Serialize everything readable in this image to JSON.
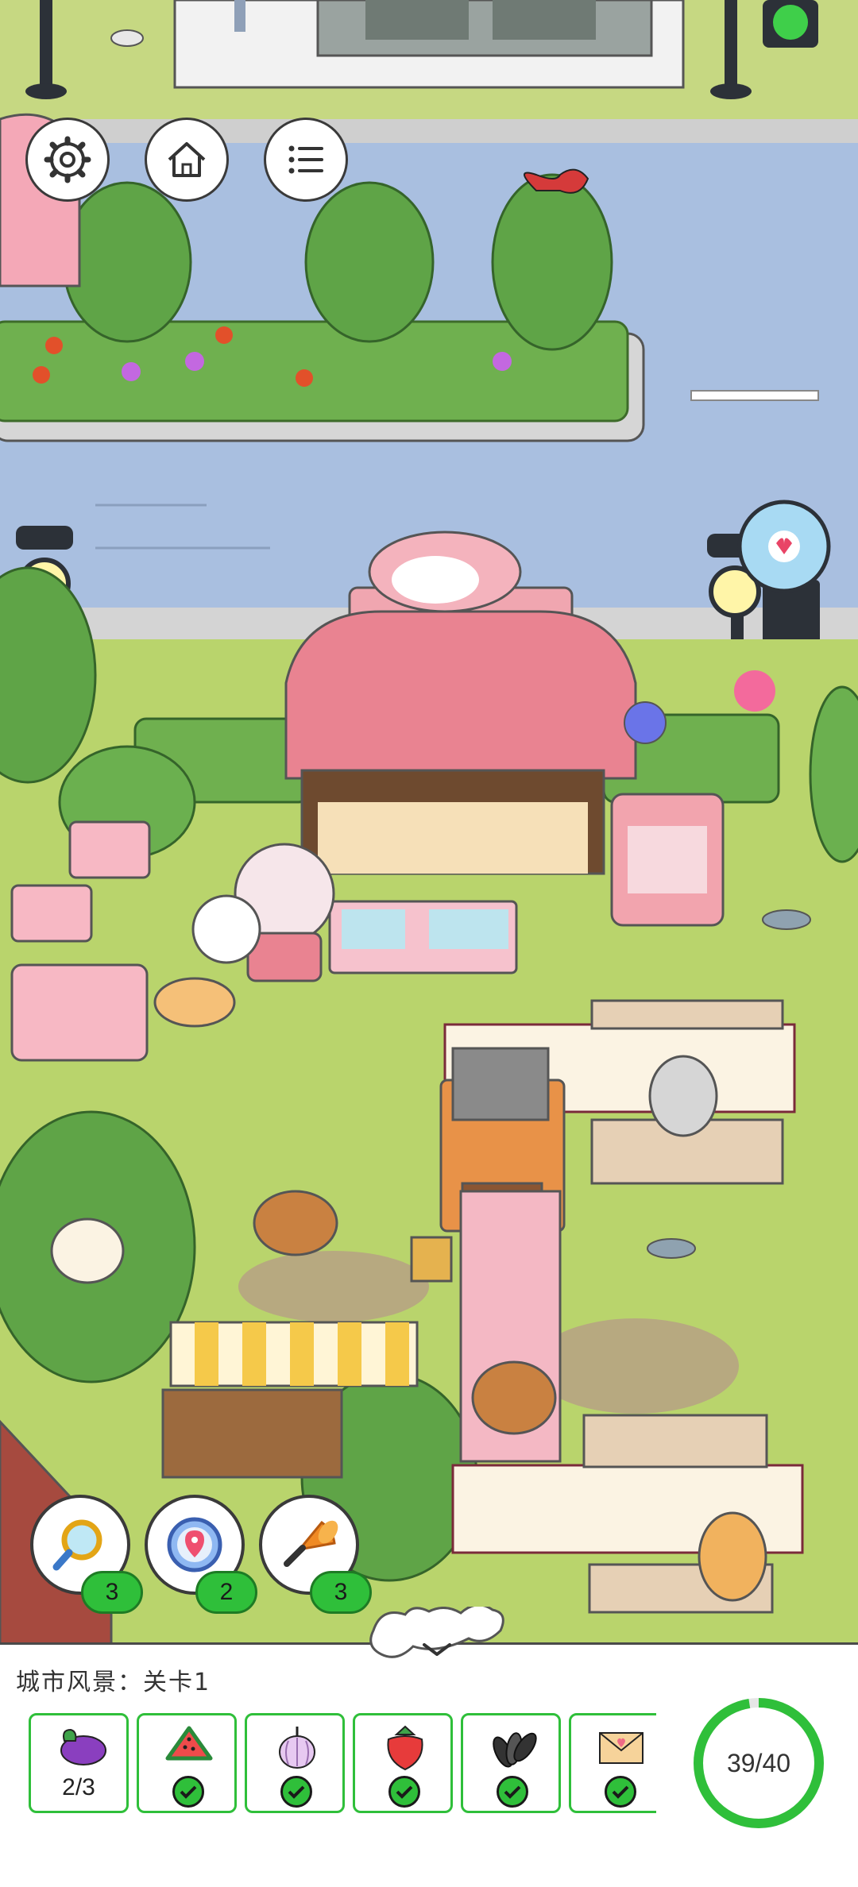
{
  "top_buttons": [
    {
      "icon": "gear-icon"
    },
    {
      "icon": "home-icon"
    },
    {
      "icon": "list-icon"
    }
  ],
  "tools": [
    {
      "icon": "magnifier-icon",
      "count": "3"
    },
    {
      "icon": "compass-icon",
      "count": "2"
    },
    {
      "icon": "horn-icon",
      "count": "3"
    }
  ],
  "panel": {
    "level_label": "城市风景：关卡1",
    "items": [
      {
        "icon": "eggplant-icon",
        "count": "2/3",
        "found": false
      },
      {
        "icon": "watermelon-icon",
        "found": true
      },
      {
        "icon": "garlic-icon",
        "found": true
      },
      {
        "icon": "strawberry-icon",
        "found": true
      },
      {
        "icon": "sunflower-seeds-icon",
        "found": true
      },
      {
        "icon": "envelope-icon",
        "found": true
      }
    ],
    "progress_text": "39/40",
    "progress_value": 0.975
  },
  "colors": {
    "accent_green": "#2fbf3a",
    "grass": "#b9d46c",
    "road": "#a9bfe0",
    "shop_pink": "#f1a5ad"
  }
}
